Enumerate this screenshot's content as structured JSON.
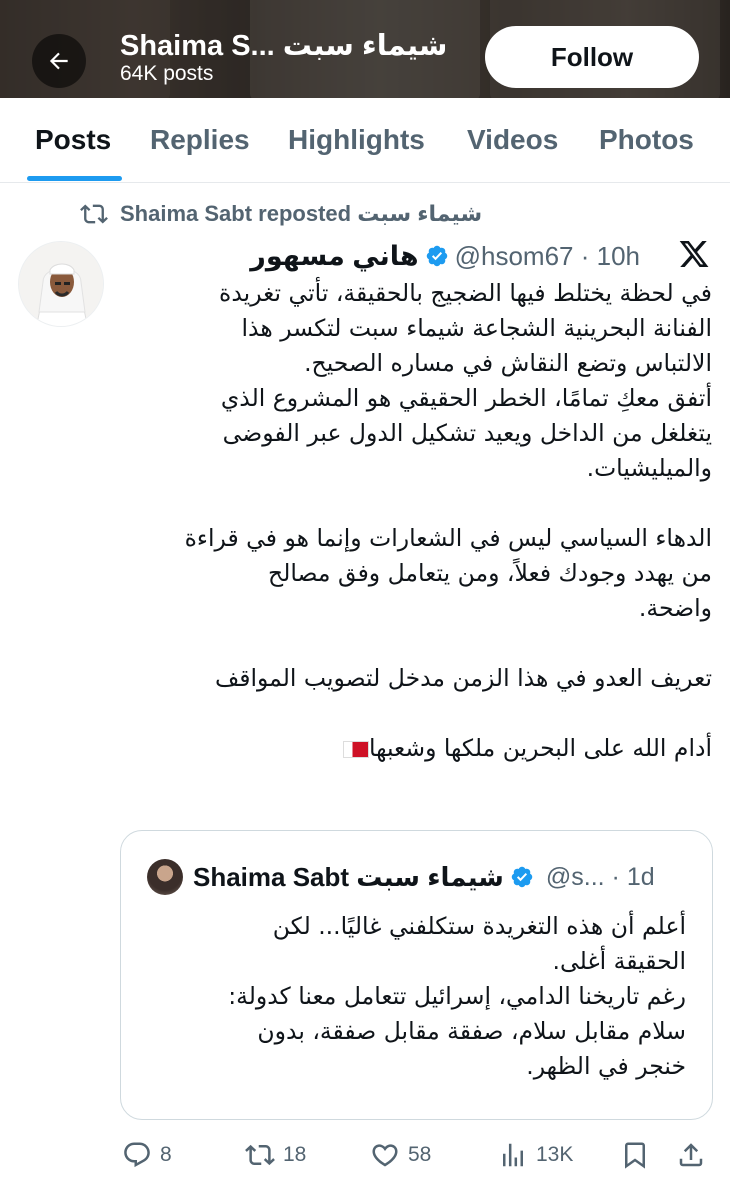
{
  "header": {
    "title": "Shaima S... شيماء سبت",
    "posts_count": "64K posts",
    "follow_label": "Follow",
    "back_icon": "arrow-left-icon"
  },
  "tabs": [
    {
      "label": "Posts",
      "active": true
    },
    {
      "label": "Replies",
      "active": false
    },
    {
      "label": "Highlights",
      "active": false
    },
    {
      "label": "Videos",
      "active": false
    },
    {
      "label": "Photos",
      "active": false
    }
  ],
  "repost": {
    "text": "Shaima Sabt reposted شيماء سبت",
    "icon": "repost-icon"
  },
  "tweet": {
    "author_name": "هاني مسهور",
    "handle": "@hsom67 · 10h",
    "platform_icon": "x-logo-icon",
    "lines": [
      "في لحظة يختلط فيها الضجيج بالحقيقة، تأتي تغريدة",
      "الفنانة البحرينية الشجاعة شيماء سبت لتكسر هذا",
      "الالتباس وتضع النقاش في مساره الصحيح.",
      "أتفق معكِ تمامًا، الخطر الحقيقي هو المشروع الذي",
      "يتغلغل من الداخل ويعيد تشكيل الدول عبر الفوضى",
      "والميليشيات.",
      "",
      "الدهاء السياسي ليس في الشعارات وإنما هو في قراءة",
      "من يهدد وجودك فعلاً، ومن يتعامل وفق مصالح",
      "واضحة.",
      "",
      "تعريف العدو في هذا الزمن مدخل لتصويب المواقف",
      "",
      "أدام الله على البحرين ملكها وشعبها"
    ]
  },
  "quote": {
    "author_name": "Shaima Sabt شيماء سبت",
    "handle": "@s... · 1d",
    "lines": [
      "أعلم أن هذه التغريدة ستكلفني غاليًا... لكن",
      "الحقيقة أغلى.",
      "رغم تاريخنا الدامي، إسرائيل تتعامل معنا كدولة:",
      "سلام مقابل سلام، صفقة مقابل صفقة، بدون",
      "خنجر في الظهر."
    ]
  },
  "actions": {
    "replies": "8",
    "reposts": "18",
    "likes": "58",
    "views": "13K"
  },
  "colors": {
    "accent": "#1d9bf0",
    "secondary_text": "#536471",
    "primary_text": "#0f1419",
    "border": "#cfd9de"
  }
}
